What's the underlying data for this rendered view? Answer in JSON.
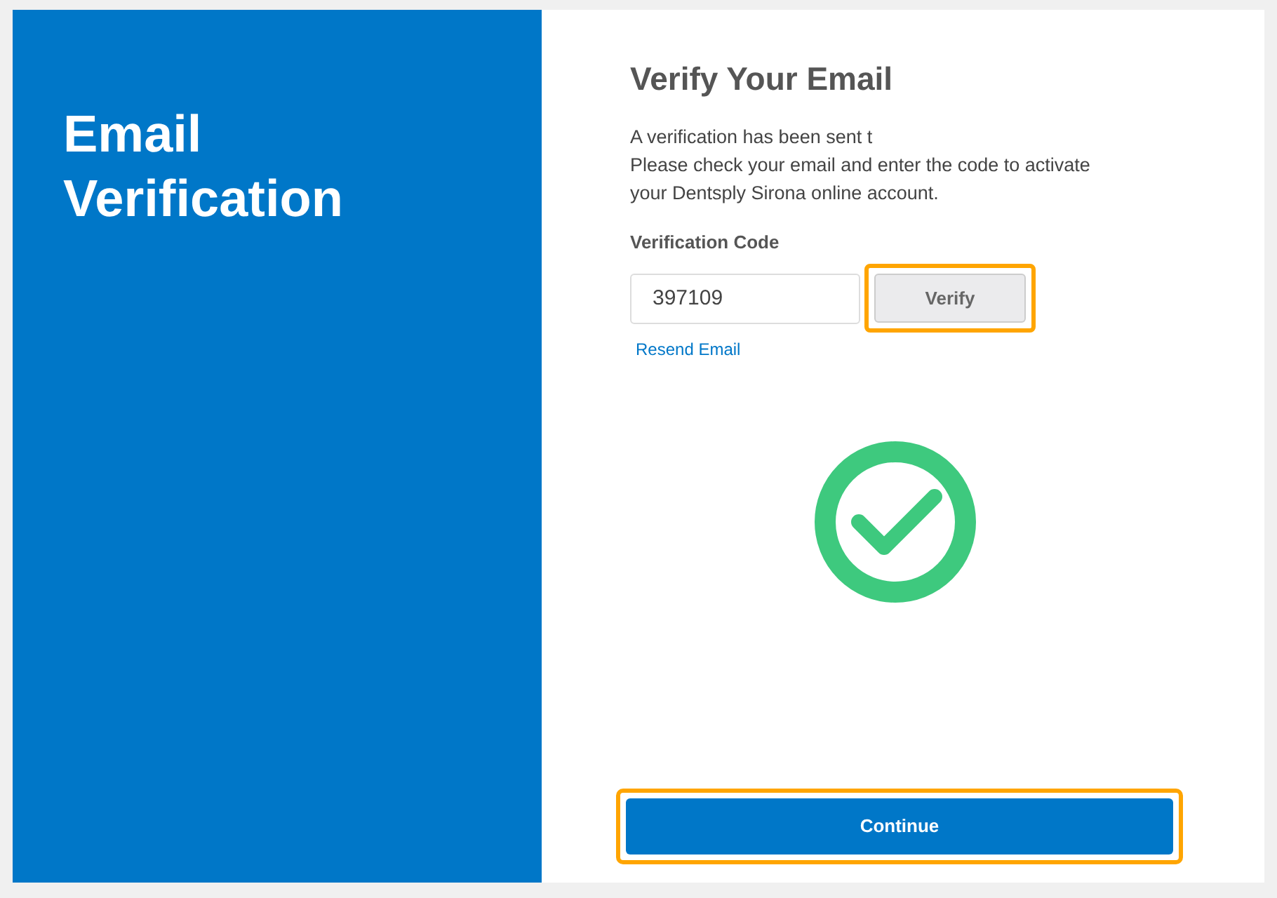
{
  "sidebar": {
    "title_lines": [
      "Email",
      "Verification"
    ]
  },
  "form": {
    "heading": "Verify Your Email",
    "message_lines": [
      "A verification has been sent t",
      "Please check your email and enter the code to activate",
      "your Dentsply Sirona online account."
    ],
    "code_label": "Verification Code",
    "code_value": "397109",
    "verify_button": {
      "label": "Verify",
      "highlighted": true
    },
    "resend_link": "Resend Email",
    "verified": true,
    "continue_button": {
      "label": "Continue",
      "highlighted": true
    }
  }
}
